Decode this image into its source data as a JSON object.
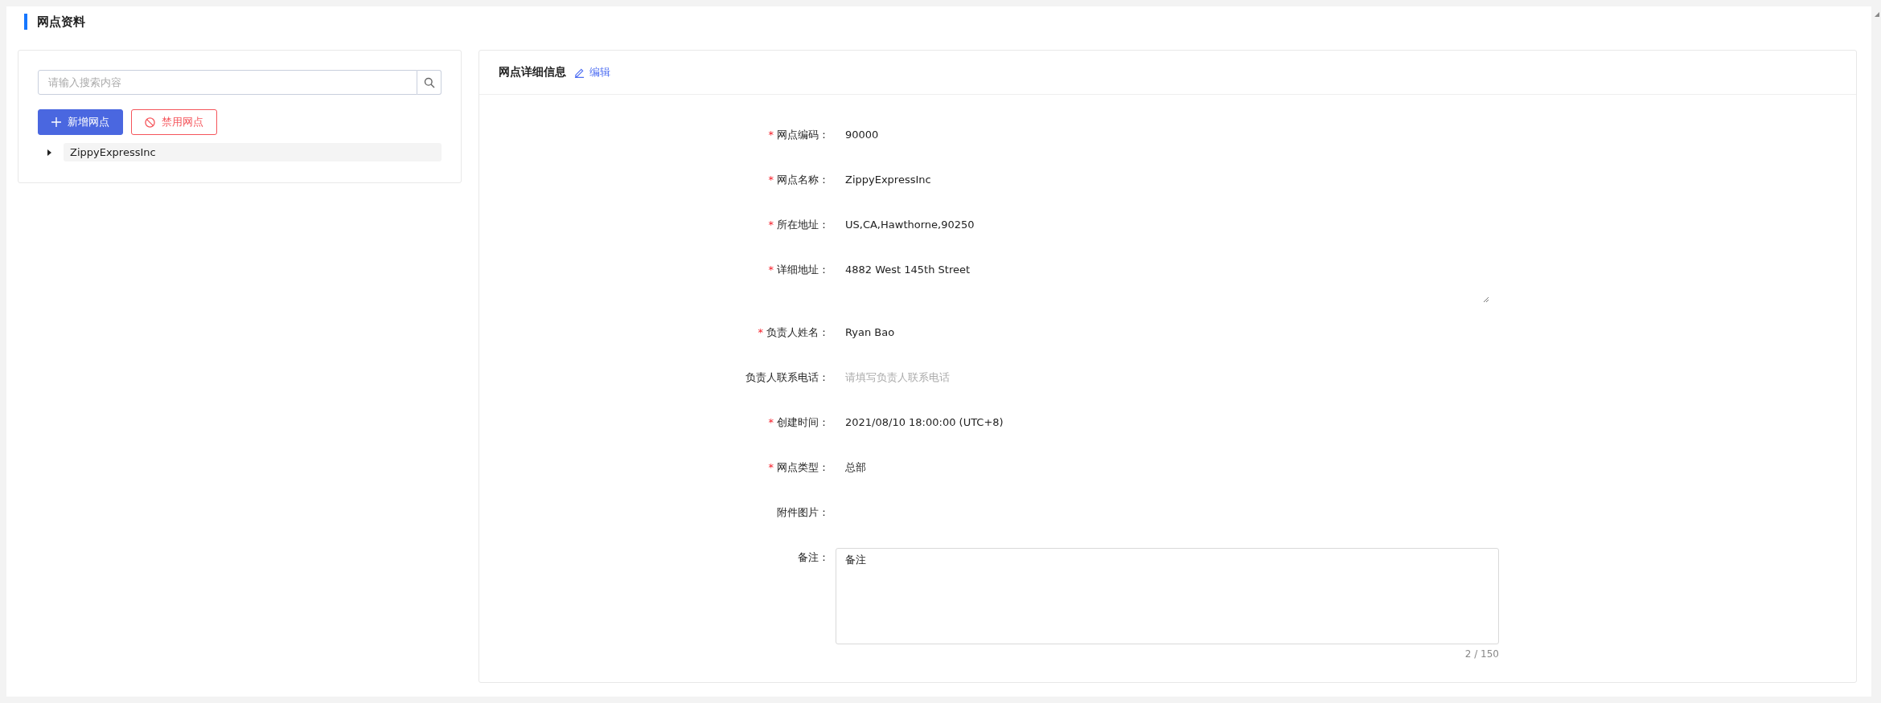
{
  "page_title": "网点资料",
  "sidebar": {
    "search": {
      "placeholder": "请输入搜索内容"
    },
    "buttons": [
      {
        "kind": "primary",
        "label": "新增网点"
      },
      {
        "kind": "danger",
        "label": "禁用网点"
      }
    ],
    "tree": [
      {
        "label": "ZippyExpressInc",
        "expanded": false
      }
    ]
  },
  "detail": {
    "title": "网点详细信息",
    "edit_link": "编辑",
    "required_mark": "*",
    "fields": [
      {
        "label": "网点编码：",
        "required": true,
        "kind": "text",
        "value": "90000"
      },
      {
        "label": "网点名称：",
        "required": true,
        "kind": "text",
        "value": "ZippyExpressInc"
      },
      {
        "label": "所在地址：",
        "required": true,
        "kind": "text",
        "value": "US,CA,Hawthorne,90250"
      },
      {
        "label": "详细地址：",
        "required": true,
        "kind": "multiline",
        "value": "4882 West 145th Street"
      },
      {
        "label": "负责人姓名：",
        "required": true,
        "kind": "text",
        "value": "Ryan Bao"
      },
      {
        "label": "负责人联系电话：",
        "required": false,
        "kind": "text",
        "placeholder": "请填写负责人联系电话"
      },
      {
        "label": "创建时间：",
        "required": true,
        "kind": "text",
        "value": "2021/08/10 18:00:00 (UTC+8)"
      },
      {
        "label": "网点类型：",
        "required": true,
        "kind": "text",
        "value": "总部"
      },
      {
        "label": "附件图片：",
        "required": false,
        "kind": "empty"
      },
      {
        "label": "备注：",
        "required": false,
        "kind": "textarea",
        "value": "备注",
        "counter": "2 / 150"
      }
    ]
  }
}
